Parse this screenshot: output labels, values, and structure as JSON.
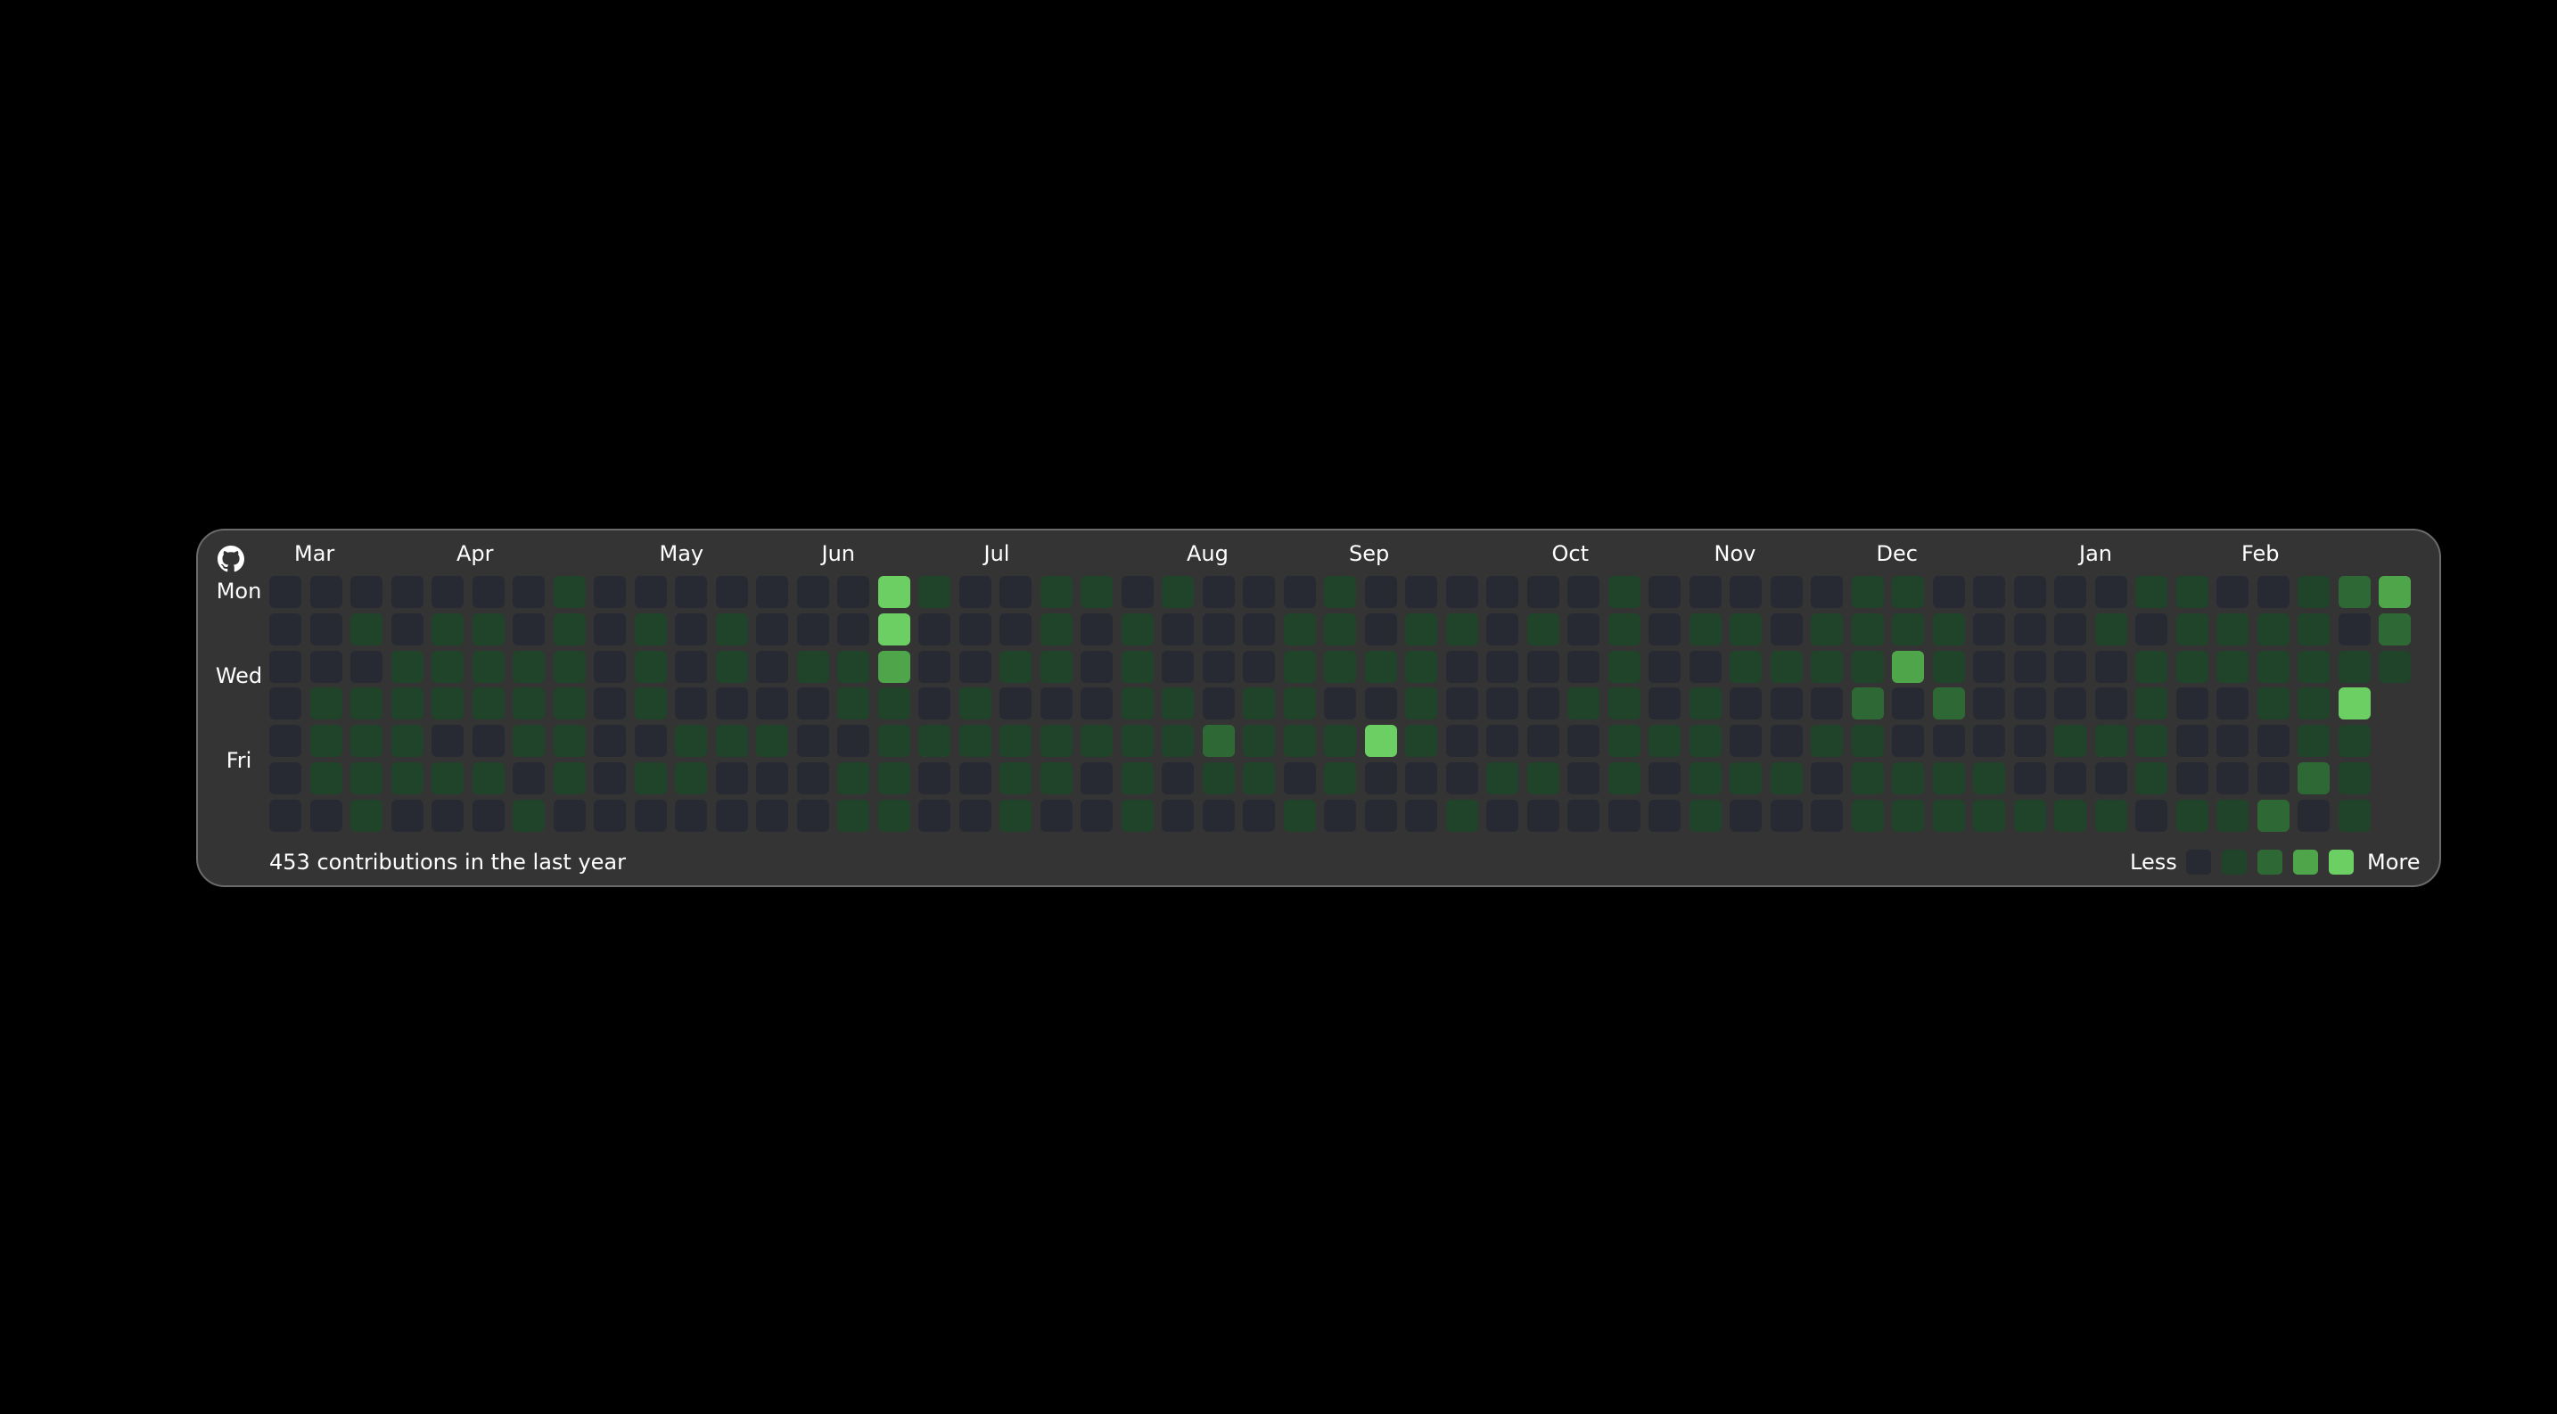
{
  "widget": {
    "icon": "github-octocat-icon",
    "summary": "453 contributions in the last year",
    "legend": {
      "less_label": "Less",
      "more_label": "More",
      "levels": [
        0,
        1,
        2,
        3,
        4
      ]
    },
    "colors": {
      "level_0": "#272a33",
      "level_1": "#1f4429",
      "level_2": "#2e6935",
      "level_3": "#4fa64a",
      "level_4": "#6bcf63",
      "card_bg": "#333433",
      "card_border": "#6b6b6b"
    },
    "day_labels": [
      {
        "label": "Mon",
        "row": 0
      },
      {
        "label": "Wed",
        "row": 2
      },
      {
        "label": "Fri",
        "row": 4
      }
    ],
    "months": [
      {
        "label": "Mar",
        "week": 0
      },
      {
        "label": "Apr",
        "week": 4
      },
      {
        "label": "May",
        "week": 9
      },
      {
        "label": "Jun",
        "week": 13
      },
      {
        "label": "Jul",
        "week": 17
      },
      {
        "label": "Aug",
        "week": 22
      },
      {
        "label": "Sep",
        "week": 26
      },
      {
        "label": "Oct",
        "week": 31
      },
      {
        "label": "Nov",
        "week": 35
      },
      {
        "label": "Dec",
        "week": 39
      },
      {
        "label": "Jan",
        "week": 44
      },
      {
        "label": "Feb",
        "week": 48
      }
    ],
    "weeks": [
      [
        0,
        0,
        0,
        0,
        0,
        0,
        0
      ],
      [
        0,
        0,
        0,
        1,
        1,
        1,
        0
      ],
      [
        0,
        1,
        0,
        1,
        1,
        1,
        1
      ],
      [
        0,
        0,
        1,
        1,
        1,
        1,
        0
      ],
      [
        0,
        1,
        1,
        1,
        0,
        1,
        0
      ],
      [
        0,
        1,
        1,
        1,
        0,
        1,
        0
      ],
      [
        0,
        0,
        1,
        1,
        1,
        0,
        1
      ],
      [
        1,
        1,
        1,
        1,
        1,
        1,
        0
      ],
      [
        0,
        0,
        0,
        0,
        0,
        0,
        0
      ],
      [
        0,
        1,
        1,
        1,
        0,
        1,
        0
      ],
      [
        0,
        0,
        0,
        0,
        1,
        1,
        0
      ],
      [
        0,
        1,
        1,
        0,
        1,
        0,
        0
      ],
      [
        0,
        0,
        0,
        0,
        1,
        0,
        0
      ],
      [
        0,
        0,
        1,
        0,
        0,
        0,
        0
      ],
      [
        0,
        0,
        1,
        1,
        0,
        1,
        1
      ],
      [
        4,
        4,
        3,
        1,
        1,
        1,
        1
      ],
      [
        1,
        0,
        0,
        0,
        1,
        0,
        0
      ],
      [
        0,
        0,
        0,
        1,
        1,
        0,
        0
      ],
      [
        0,
        0,
        1,
        0,
        1,
        1,
        1
      ],
      [
        1,
        1,
        1,
        0,
        1,
        1,
        0
      ],
      [
        1,
        0,
        0,
        0,
        1,
        0,
        0
      ],
      [
        0,
        1,
        1,
        1,
        1,
        1,
        1
      ],
      [
        1,
        0,
        0,
        1,
        1,
        0,
        0
      ],
      [
        0,
        0,
        0,
        0,
        2,
        1,
        0
      ],
      [
        0,
        0,
        0,
        1,
        1,
        1,
        0
      ],
      [
        0,
        1,
        1,
        1,
        1,
        0,
        1
      ],
      [
        1,
        1,
        1,
        0,
        1,
        1,
        0
      ],
      [
        0,
        0,
        1,
        0,
        4,
        0,
        0
      ],
      [
        0,
        1,
        1,
        1,
        1,
        0,
        0
      ],
      [
        0,
        1,
        0,
        0,
        0,
        0,
        1
      ],
      [
        0,
        0,
        0,
        0,
        0,
        1,
        0
      ],
      [
        0,
        1,
        0,
        0,
        0,
        1,
        0
      ],
      [
        0,
        0,
        0,
        1,
        0,
        0,
        0
      ],
      [
        1,
        1,
        1,
        1,
        1,
        1,
        0
      ],
      [
        0,
        0,
        0,
        0,
        1,
        0,
        0
      ],
      [
        0,
        1,
        0,
        1,
        1,
        1,
        1
      ],
      [
        0,
        1,
        1,
        0,
        0,
        1,
        0
      ],
      [
        0,
        0,
        1,
        0,
        0,
        1,
        0
      ],
      [
        0,
        1,
        1,
        0,
        1,
        0,
        0
      ],
      [
        1,
        1,
        1,
        2,
        1,
        1,
        1
      ],
      [
        1,
        1,
        3,
        0,
        0,
        1,
        1
      ],
      [
        0,
        1,
        1,
        2,
        0,
        1,
        1
      ],
      [
        0,
        0,
        0,
        0,
        0,
        1,
        1
      ],
      [
        0,
        0,
        0,
        0,
        0,
        0,
        1
      ],
      [
        0,
        0,
        0,
        0,
        1,
        0,
        1
      ],
      [
        0,
        1,
        0,
        0,
        1,
        0,
        1
      ],
      [
        1,
        0,
        1,
        1,
        1,
        1,
        0
      ],
      [
        1,
        1,
        1,
        0,
        0,
        0,
        1
      ],
      [
        0,
        1,
        1,
        0,
        0,
        0,
        1
      ],
      [
        0,
        1,
        1,
        1,
        0,
        0,
        2
      ],
      [
        1,
        1,
        1,
        1,
        1,
        2,
        0
      ],
      [
        2,
        0,
        1,
        4,
        1,
        1,
        1
      ],
      [
        3,
        2,
        1
      ]
    ]
  }
}
